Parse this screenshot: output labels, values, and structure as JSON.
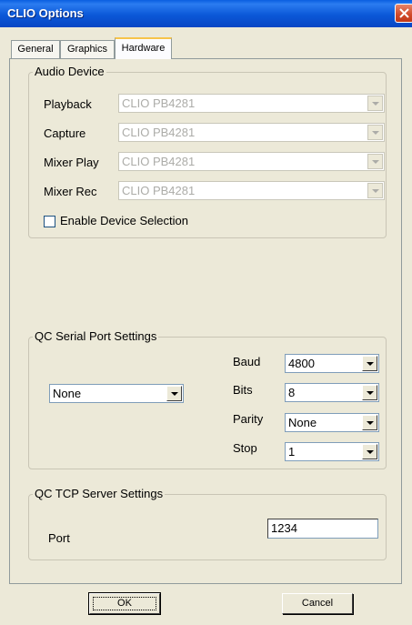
{
  "window": {
    "title": "CLIO Options"
  },
  "tabs": [
    {
      "label": "General"
    },
    {
      "label": "Graphics"
    },
    {
      "label": "Hardware"
    }
  ],
  "audio_device": {
    "legend": "Audio Device",
    "rows": [
      {
        "label": "Playback",
        "value": "CLIO PB4281"
      },
      {
        "label": "Capture",
        "value": "CLIO PB4281"
      },
      {
        "label": "Mixer Play",
        "value": "CLIO PB4281"
      },
      {
        "label": "Mixer Rec",
        "value": "CLIO PB4281"
      }
    ],
    "enable_label": "Enable Device Selection",
    "enable_checked": false
  },
  "qc_serial": {
    "legend": "QC Serial Port Settings",
    "port_value": "None",
    "baud_label": "Baud",
    "baud_value": "4800",
    "bits_label": "Bits",
    "bits_value": "8",
    "parity_label": "Parity",
    "parity_value": "None",
    "stop_label": "Stop",
    "stop_value": "1"
  },
  "qc_tcp": {
    "legend": "QC TCP Server Settings",
    "port_label": "Port",
    "port_value": "1234"
  },
  "buttons": {
    "ok": "OK",
    "cancel": "Cancel"
  },
  "colors": {
    "titlebar": "#0b58d8",
    "dialog_bg": "#ece9d8",
    "close": "#d04828"
  },
  "icons": {
    "close": "close-icon",
    "dropdown": "chevron-down-icon"
  }
}
